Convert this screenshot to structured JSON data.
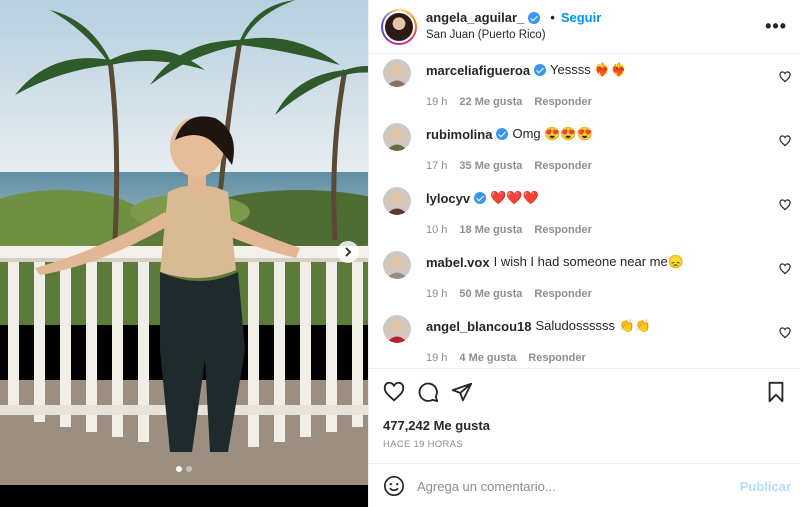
{
  "header": {
    "username": "angela_aguilar_",
    "separator": "•",
    "follow_label": "Seguir",
    "location": "San Juan (Puerto Rico)",
    "more_label": "•••"
  },
  "media": {
    "slide_count": 2,
    "active_slide": 1
  },
  "comments": [
    {
      "username": "marceliafigueroa",
      "verified": true,
      "text": "Yessss ❤️‍🔥❤️‍🔥",
      "time": "19 h",
      "likes": "22 Me gusta",
      "reply": "Responder",
      "avatar_color": "#8a6f62"
    },
    {
      "username": "rubimolina",
      "verified": true,
      "text": "Omg 😍😍😍",
      "time": "17 h",
      "likes": "35 Me gusta",
      "reply": "Responder",
      "avatar_color": "#6b6a3a"
    },
    {
      "username": "lylocyv",
      "verified": true,
      "text": "❤️❤️❤️",
      "time": "10 h",
      "likes": "18 Me gusta",
      "reply": "Responder",
      "avatar_color": "#5a3b30"
    },
    {
      "username": "mabel.vox",
      "verified": false,
      "text": "I wish I had someone near me😞",
      "time": "19 h",
      "likes": "50 Me gusta",
      "reply": "Responder",
      "avatar_color": "#9a8a80"
    },
    {
      "username": "angel_blancou18",
      "verified": false,
      "text": "Saludossssss 👏👏",
      "time": "19 h",
      "likes": "4 Me gusta",
      "reply": "Responder",
      "avatar_color": "#b8232a"
    }
  ],
  "actions": {
    "likes_text": "477,242 Me gusta",
    "time_text": "HACE 19 HORAS"
  },
  "composer": {
    "placeholder": "Agrega un comentario...",
    "post_label": "Publicar"
  },
  "colors": {
    "accent": "#0095f6",
    "verified": "#3897f0",
    "muted": "#8e8e8e",
    "post_disabled": "#b2dffc"
  }
}
